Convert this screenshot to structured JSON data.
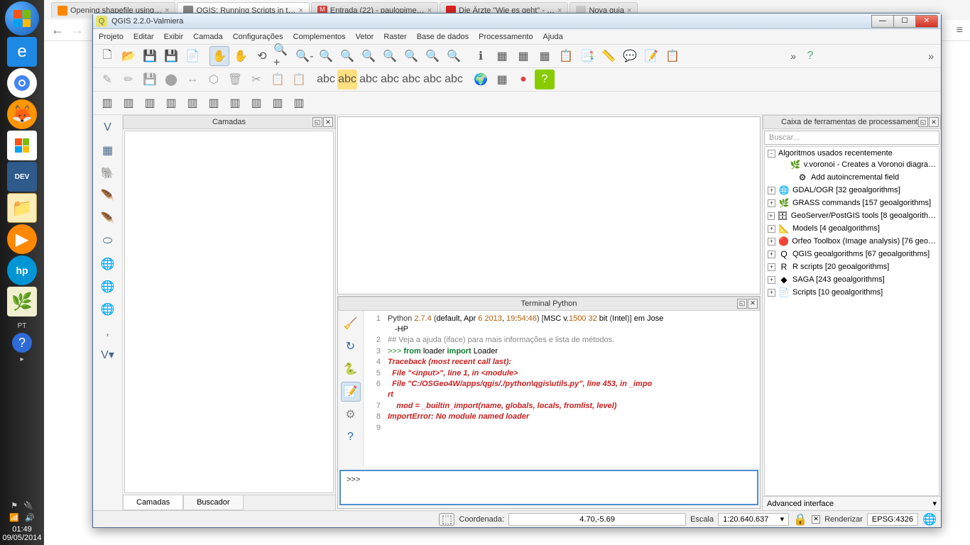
{
  "desktop": {
    "lang": "PT",
    "clock_time": "01:49",
    "clock_date": "09/05/2014"
  },
  "browser": {
    "tabs": [
      {
        "label": "Opening shapefile using…",
        "fav": "#ff8800"
      },
      {
        "label": "QGIS: Running Scripts in t…",
        "fav": "#888",
        "active": true
      },
      {
        "label": "Entrada (22) - paulopime…",
        "fav": "#d44"
      },
      {
        "label": "Die Ärzte \"Wie es geht\" - …",
        "fav": "#d22"
      },
      {
        "label": "Nova guia",
        "fav": "#ccc"
      }
    ]
  },
  "qgis": {
    "title": "QGIS 2.2.0-Valmiera",
    "menu": [
      "Projeto",
      "Editar",
      "Exibir",
      "Camada",
      "Configurações",
      "Complementos",
      "Vetor",
      "Raster",
      "Base de dados",
      "Processamento",
      "Ajuda"
    ],
    "layers": {
      "title": "Camadas",
      "tabs": [
        "Camadas",
        "Buscador"
      ]
    },
    "python": {
      "title": "Terminal Python",
      "prompt": ">>>",
      "lines": [
        "Python 2.7.4 (default, Apr  6 2013, 19:54:46) [MSC v.1500 32 bit (Intel)] em Jose-HP",
        "## Veja a ajuda (iface) para mais informações e lista de métodos.",
        ">>> from loader import  Loader",
        "Traceback (most recent call last):",
        "  File \"<input>\", line 1, in <module>",
        "  File \"C:/OSGeo4W/apps/qgis/./python\\qgis\\utils.py\", line 453, in _import",
        "    mod = _builtin_import(name, globals, locals, fromlist, level)",
        "ImportError: No module named loader",
        ""
      ]
    },
    "toolbox": {
      "title": "Caixa de ferramentas de processamento",
      "search_placeholder": "Buscar...",
      "interface": "Advanced interface",
      "tree": [
        {
          "expand": "-",
          "label": "Algoritmos usados recentemente"
        },
        {
          "indent": 1,
          "ico": "🌿",
          "label": "v.voronoi - Creates a Voronoi diagra…"
        },
        {
          "indent": 1,
          "ico": "⚙",
          "label": "Add autoincremental field"
        },
        {
          "expand": "+",
          "ico": "🌐",
          "label": "GDAL/OGR [32 geoalgorithms]"
        },
        {
          "expand": "+",
          "ico": "🌿",
          "label": "GRASS commands [157 geoalgorithms]"
        },
        {
          "expand": "+",
          "ico": "🗄",
          "label": "GeoServer/PostGIS tools [8 geoalgorith…"
        },
        {
          "expand": "+",
          "ico": "📐",
          "label": "Models [4 geoalgorithms]"
        },
        {
          "expand": "+",
          "ico": "🔴",
          "label": "Orfeo Toolbox (Image analysis) [76 geo…"
        },
        {
          "expand": "+",
          "ico": "Q",
          "label": "QGIS geoalgorithms [67 geoalgorithms]"
        },
        {
          "expand": "+",
          "ico": "R",
          "label": "R scripts [20 geoalgorithms]"
        },
        {
          "expand": "+",
          "ico": "◆",
          "label": "SAGA [243 geoalgorithms]"
        },
        {
          "expand": "+",
          "ico": "📄",
          "label": "Scripts [10 geoalgorithms]"
        }
      ]
    },
    "status": {
      "coord_label": "Coordenada:",
      "coord_value": "4.70,-5.69",
      "scale_label": "Escala",
      "scale_value": "1:20.640.637",
      "render": "Renderizar",
      "crs": "EPSG:4326"
    }
  }
}
